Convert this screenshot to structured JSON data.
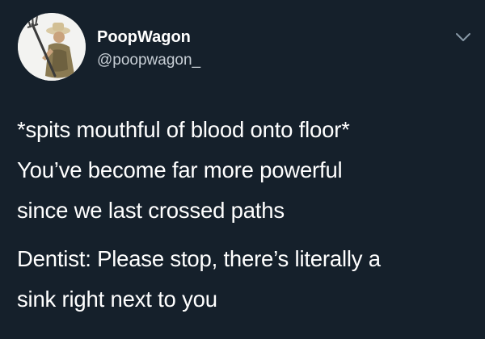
{
  "tweet": {
    "display_name": "PoopWagon",
    "handle": "@poopwagon_",
    "menu_icon": "chevron-down-icon",
    "avatar_icon": "pitchfork-farmer-avatar",
    "lines": [
      "*spits mouthful of blood onto floor*",
      "You’ve become far more powerful",
      "since we last crossed paths"
    ],
    "lines2": [
      "Dentist: Please stop, there’s literally a",
      "sink right next to you"
    ]
  },
  "colors": {
    "background": "#15202b",
    "text": "#ffffff",
    "handle": "#c7ced5"
  }
}
